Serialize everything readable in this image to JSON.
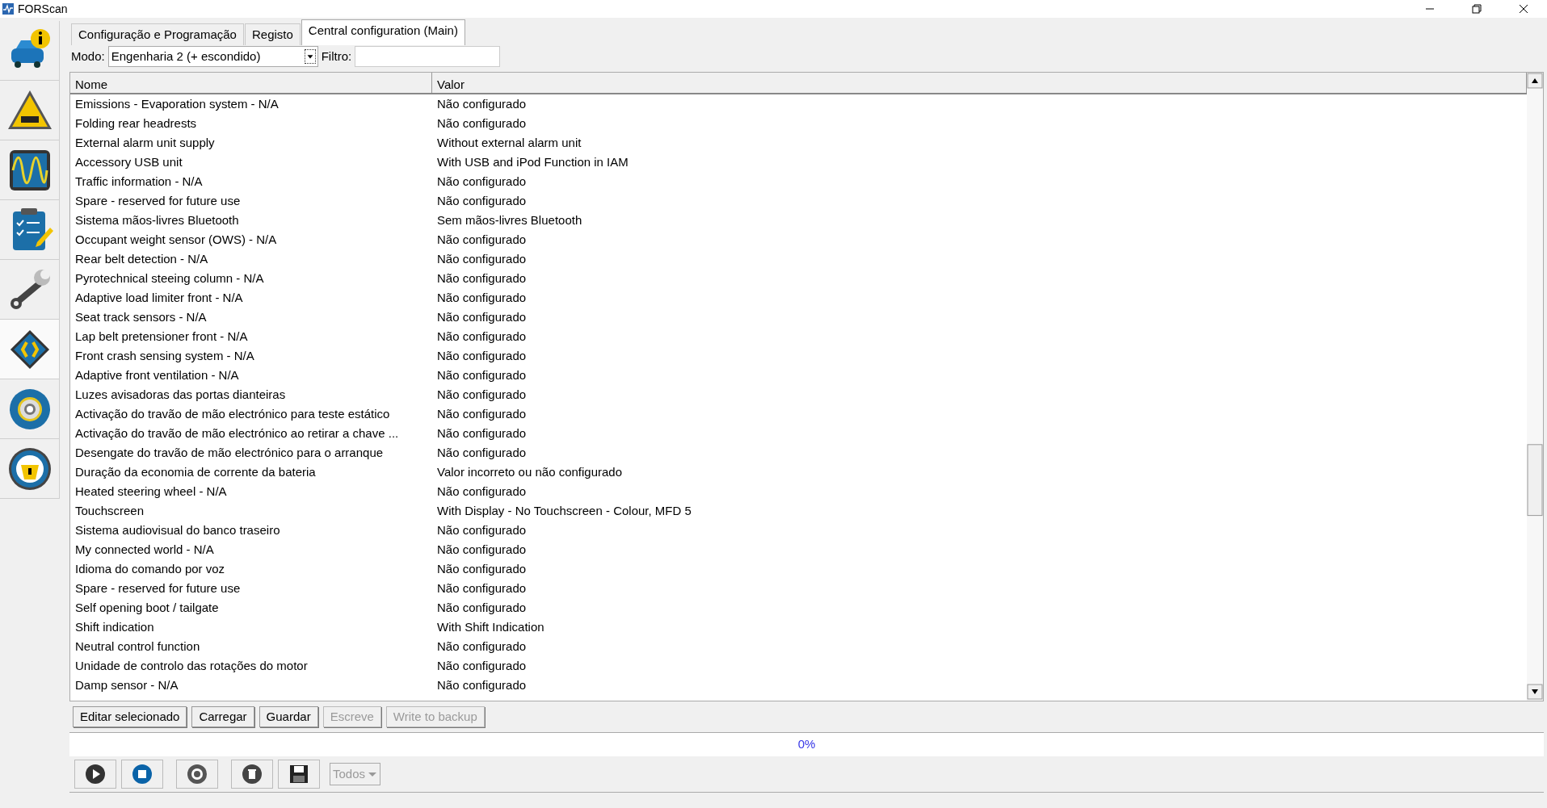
{
  "window": {
    "title": "FORScan"
  },
  "tabs": [
    {
      "label": "Configuração e Programação",
      "selected": false
    },
    {
      "label": "Registo",
      "selected": false
    },
    {
      "label": "Central configuration (Main)",
      "selected": true
    }
  ],
  "mode": {
    "label": "Modo:",
    "value": "Engenharia 2 (+ escondido)"
  },
  "filter": {
    "label": "Filtro:"
  },
  "table": {
    "columns": [
      "Nome",
      "Valor"
    ],
    "rows": [
      [
        "Emissions - Evaporation system - N/A",
        "Não configurado"
      ],
      [
        "Folding rear headrests",
        "Não configurado"
      ],
      [
        "External alarm unit supply",
        "Without external alarm unit"
      ],
      [
        "Accessory USB unit",
        "With USB and iPod Function in IAM"
      ],
      [
        "Traffic information - N/A",
        "Não configurado"
      ],
      [
        "Spare - reserved for future use",
        "Não configurado"
      ],
      [
        "Sistema mãos-livres Bluetooth",
        "Sem mãos-livres Bluetooth"
      ],
      [
        "Occupant weight sensor (OWS) - N/A",
        "Não configurado"
      ],
      [
        "Rear belt detection - N/A",
        "Não configurado"
      ],
      [
        "Pyrotechnical steeing column - N/A",
        "Não configurado"
      ],
      [
        "Adaptive load limiter front - N/A",
        "Não configurado"
      ],
      [
        "Seat track sensors - N/A",
        "Não configurado"
      ],
      [
        "Lap belt pretensioner front - N/A",
        "Não configurado"
      ],
      [
        "Front crash sensing system - N/A",
        "Não configurado"
      ],
      [
        "Adaptive front ventilation - N/A",
        "Não configurado"
      ],
      [
        "Luzes avisadoras das portas dianteiras",
        "Não configurado"
      ],
      [
        "Activação do travão de mão electrónico para teste estático",
        "Não configurado"
      ],
      [
        "Activação do travão de mão electrónico ao retirar a chave ...",
        "Não configurado"
      ],
      [
        "Desengate do travão de mão electrónico para o arranque",
        "Não configurado"
      ],
      [
        "Duração da economia de corrente da bateria",
        "Valor incorreto ou não configurado"
      ],
      [
        "Heated steering wheel - N/A",
        "Não configurado"
      ],
      [
        "Touchscreen",
        "With Display - No Touchscreen - Colour, MFD 5"
      ],
      [
        "Sistema audiovisual do banco traseiro",
        "Não configurado"
      ],
      [
        "My connected world - N/A",
        "Não configurado"
      ],
      [
        "Idioma do comando por voz",
        "Não configurado"
      ],
      [
        "Spare - reserved for future use",
        "Não configurado"
      ],
      [
        "Self opening boot / tailgate",
        "Não configurado"
      ],
      [
        "Shift indication",
        "With Shift Indication"
      ],
      [
        "Neutral control function",
        "Não configurado"
      ],
      [
        "Unidade de controlo das rotações do motor",
        "Não configurado"
      ],
      [
        "Damp sensor - N/A",
        "Não configurado"
      ]
    ]
  },
  "buttons": [
    {
      "label": "Editar selecionado",
      "disabled": false
    },
    {
      "label": "Carregar",
      "disabled": false
    },
    {
      "label": "Guardar",
      "disabled": false
    },
    {
      "label": "Escreve",
      "disabled": true
    },
    {
      "label": "Write to backup",
      "disabled": true
    }
  ],
  "progress": {
    "level": 0,
    "reading": "0%"
  },
  "toolbar": {
    "dropdown": {
      "value": "Todos",
      "disabled": true
    }
  }
}
